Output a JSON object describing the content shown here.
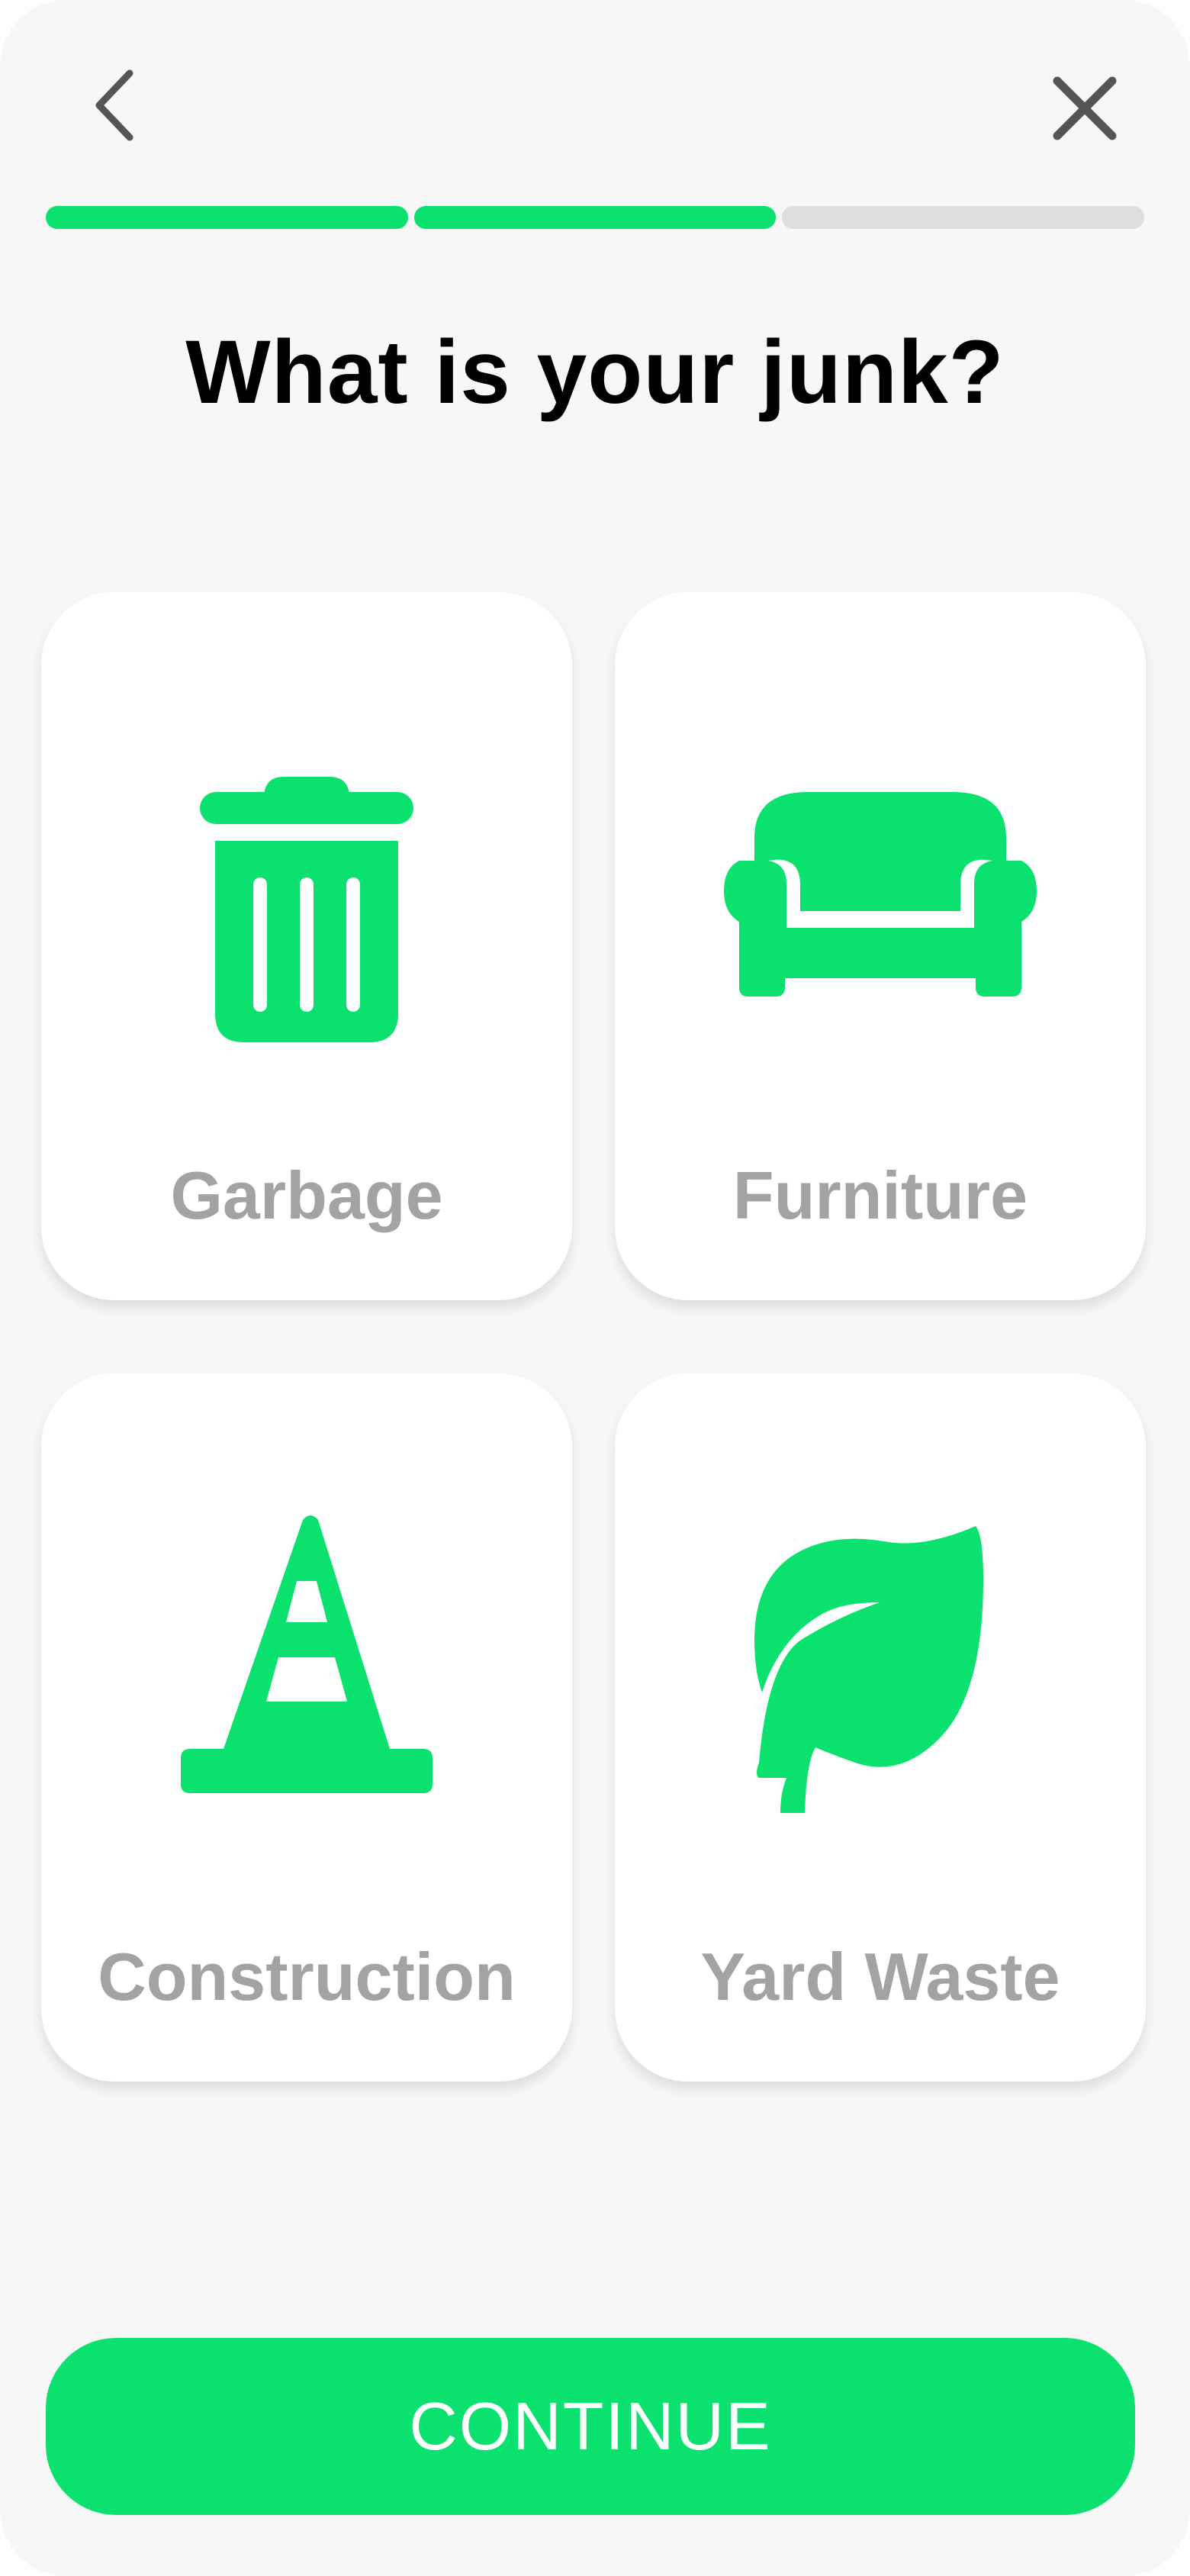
{
  "header": {
    "back_icon": "chevron-left-icon",
    "close_icon": "close-icon"
  },
  "progress": {
    "total_steps": 3,
    "completed_steps": 2,
    "active_color": "#0ae16e",
    "inactive_color": "#dedede"
  },
  "title": "What is your junk?",
  "options": [
    {
      "label": "Garbage",
      "icon": "trash-can-icon"
    },
    {
      "label": "Furniture",
      "icon": "sofa-icon"
    },
    {
      "label": "Construction",
      "icon": "traffic-cone-icon"
    },
    {
      "label": "Yard Waste",
      "icon": "leaf-icon"
    }
  ],
  "continue_label": "CONTINUE",
  "colors": {
    "accent": "#0ae16e",
    "label_gray": "#a3a3a3",
    "background": "#f7f7f7"
  }
}
